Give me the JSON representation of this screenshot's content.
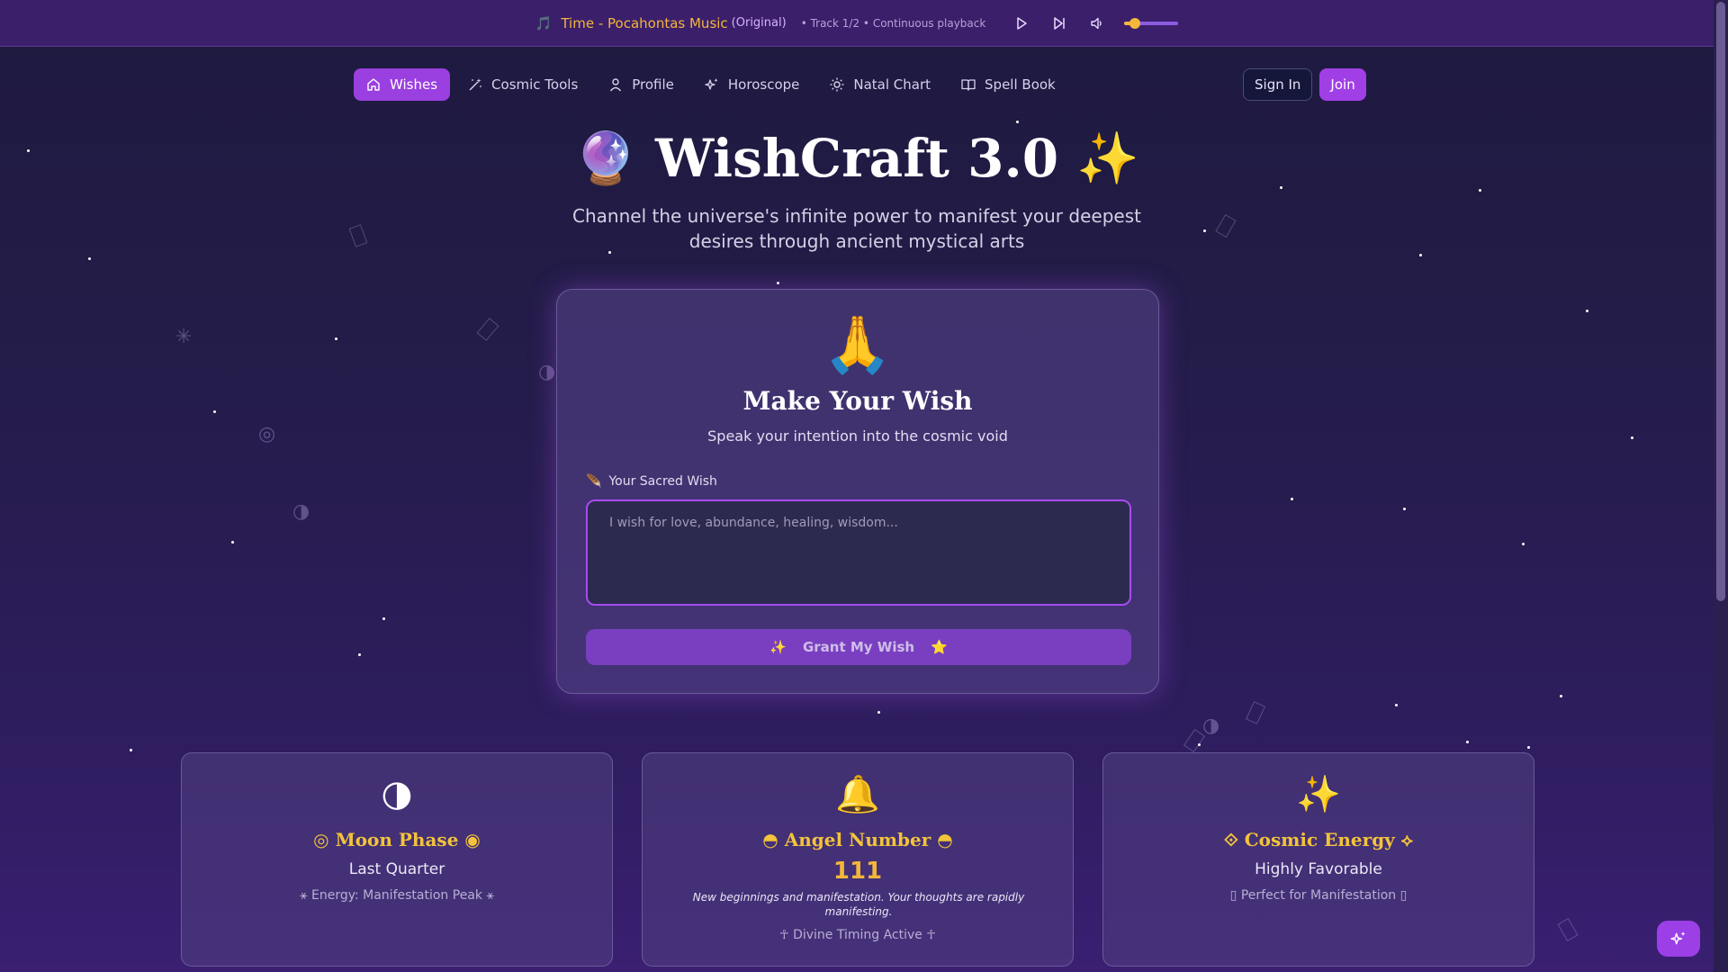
{
  "music": {
    "note_icon": "🎵",
    "title": "Time - Pocahontas Music",
    "subtitle": "(Original)",
    "meta": "• Track 1/2 • Continuous playback",
    "volume": 0.2
  },
  "nav": {
    "items": [
      {
        "label": "Wishes",
        "icon": "home-icon"
      },
      {
        "label": "Cosmic Tools",
        "icon": "wand-icon"
      },
      {
        "label": "Profile",
        "icon": "user-icon"
      },
      {
        "label": "Horoscope",
        "icon": "sparkles-icon"
      },
      {
        "label": "Natal Chart",
        "icon": "sun-icon"
      },
      {
        "label": "Spell Book",
        "icon": "book-icon"
      }
    ],
    "sign_in": "Sign In",
    "join": "Join"
  },
  "hero": {
    "emoji_left": "🔮",
    "title": "WishCraft 3.0",
    "emoji_right": "✨",
    "subtitle": "Channel the universe's infinite power to manifest your deepest desires through ancient mystical arts"
  },
  "wish": {
    "icon": "🙏",
    "title": "Make Your Wish",
    "subtitle": "Speak your intention into the cosmic void",
    "label_icon": "🪶",
    "label": "Your Sacred Wish",
    "placeholder": "I wish for love, abundance, healing, wisdom...",
    "button_left": "✨",
    "button": "Grant My Wish",
    "button_right": "⭐"
  },
  "cards": {
    "moon": {
      "icon": "◑",
      "title": "◎ Moon Phase ◉",
      "value": "Last Quarter",
      "footer": "⚹ Energy: Manifestation Peak ⚹"
    },
    "angel": {
      "icon": "🔔",
      "title": "◓ Angel Number ◓",
      "number": "111",
      "description": "New beginnings and manifestation. Your thoughts are rapidly manifesting.",
      "footer": "☥ Divine Timing Active ☥"
    },
    "energy": {
      "icon": "✨",
      "title": "⟐ Cosmic Energy ⟡",
      "value": "Highly Favorable",
      "footer": "▯ Perfect for Manifestation ▯"
    }
  },
  "colors": {
    "accent": "#9a3fe0",
    "gold": "#f3b73a",
    "background": "#241c4a"
  }
}
